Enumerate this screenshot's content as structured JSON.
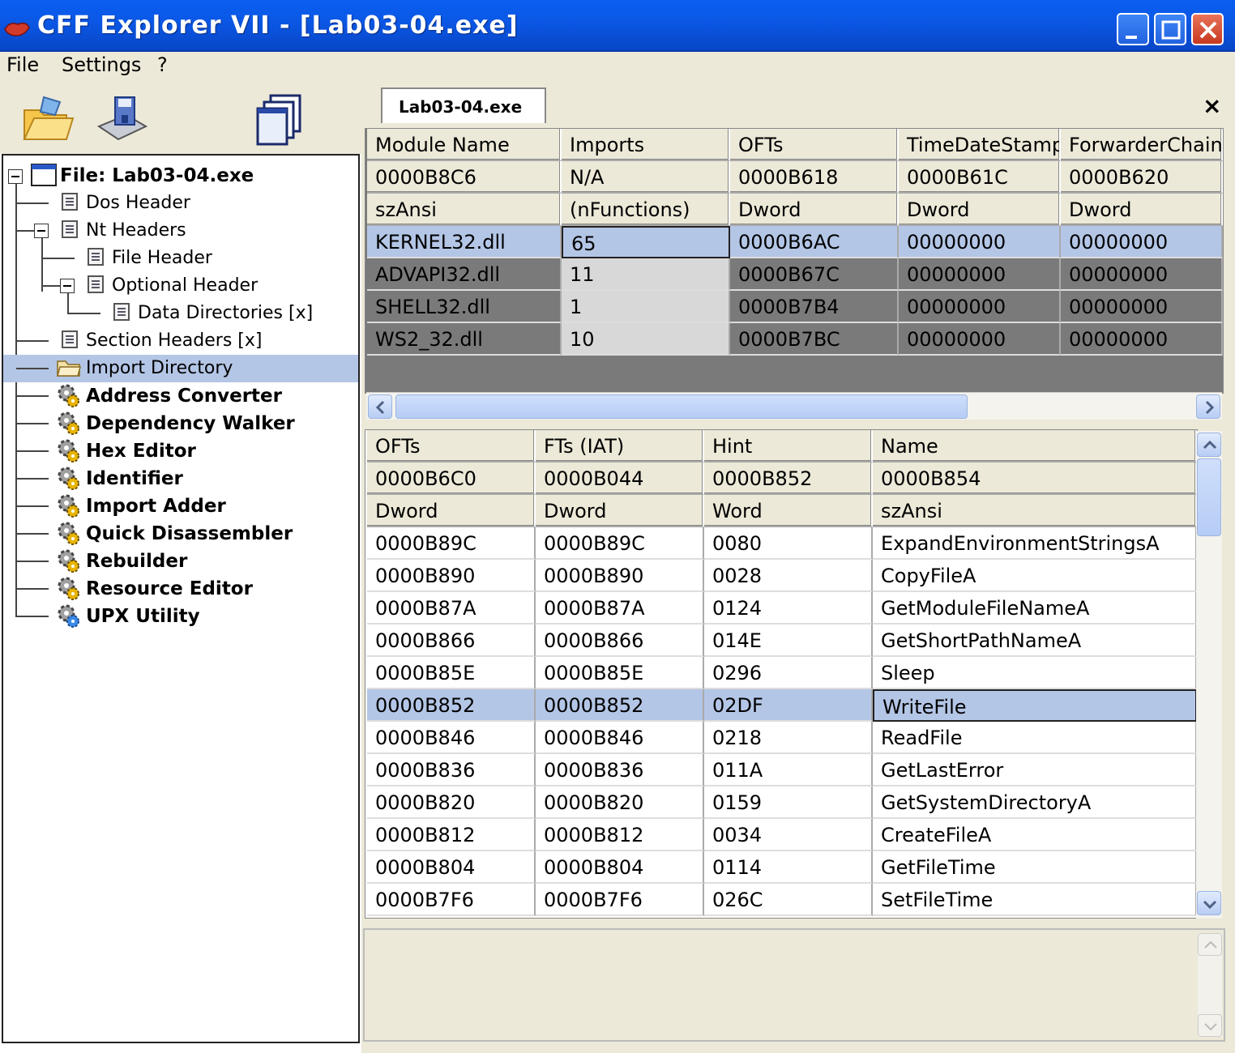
{
  "window": {
    "title": "CFF Explorer VII - [Lab03-04.exe]"
  },
  "menu": {
    "items": [
      "File",
      "Settings",
      "?"
    ]
  },
  "toolbar": {
    "tools": [
      "open-folder-icon",
      "save-disk-icon",
      "windows-icon"
    ]
  },
  "tree": {
    "root": "File: Lab03-04.exe",
    "items": [
      {
        "label": "Dos Header"
      },
      {
        "label": "Nt Headers"
      },
      {
        "label": "File Header"
      },
      {
        "label": "Optional Header"
      },
      {
        "label": "Data Directories [x]"
      },
      {
        "label": "Section Headers [x]"
      },
      {
        "label": "Import Directory"
      },
      {
        "label": "Address Converter"
      },
      {
        "label": "Dependency Walker"
      },
      {
        "label": "Hex Editor"
      },
      {
        "label": "Identifier"
      },
      {
        "label": "Import Adder"
      },
      {
        "label": "Quick Disassembler"
      },
      {
        "label": "Rebuilder"
      },
      {
        "label": "Resource Editor"
      },
      {
        "label": "UPX Utility"
      }
    ]
  },
  "tab": {
    "label": "Lab03-04.exe",
    "close": "×"
  },
  "modules_table": {
    "headers": [
      "Module Name",
      "Imports",
      "OFTs",
      "TimeDateStamp",
      "ForwarderChain"
    ],
    "offsets": [
      "0000B8C6",
      "N/A",
      "0000B618",
      "0000B61C",
      "0000B620"
    ],
    "types": [
      "szAnsi",
      "(nFunctions)",
      "Dword",
      "Dword",
      "Dword"
    ],
    "rows": [
      [
        "KERNEL32.dll",
        "65",
        "0000B6AC",
        "00000000",
        "00000000"
      ],
      [
        "ADVAPI32.dll",
        "11",
        "0000B67C",
        "00000000",
        "00000000"
      ],
      [
        "SHELL32.dll",
        "1",
        "0000B7B4",
        "00000000",
        "00000000"
      ],
      [
        "WS2_32.dll",
        "10",
        "0000B7BC",
        "00000000",
        "00000000"
      ]
    ]
  },
  "functions_table": {
    "headers": [
      "OFTs",
      "FTs (IAT)",
      "Hint",
      "Name"
    ],
    "offsets": [
      "0000B6C0",
      "0000B044",
      "0000B852",
      "0000B854"
    ],
    "types": [
      "Dword",
      "Dword",
      "Word",
      "szAnsi"
    ],
    "rows": [
      [
        "0000B89C",
        "0000B89C",
        "0080",
        "ExpandEnvironmentStringsA"
      ],
      [
        "0000B890",
        "0000B890",
        "0028",
        "CopyFileA"
      ],
      [
        "0000B87A",
        "0000B87A",
        "0124",
        "GetModuleFileNameA"
      ],
      [
        "0000B866",
        "0000B866",
        "014E",
        "GetShortPathNameA"
      ],
      [
        "0000B85E",
        "0000B85E",
        "0296",
        "Sleep"
      ],
      [
        "0000B852",
        "0000B852",
        "02DF",
        "WriteFile"
      ],
      [
        "0000B846",
        "0000B846",
        "0218",
        "ReadFile"
      ],
      [
        "0000B836",
        "0000B836",
        "011A",
        "GetLastError"
      ],
      [
        "0000B820",
        "0000B820",
        "0159",
        "GetSystemDirectoryA"
      ],
      [
        "0000B812",
        "0000B812",
        "0034",
        "CreateFileA"
      ],
      [
        "0000B804",
        "0000B804",
        "0114",
        "GetFileTime"
      ],
      [
        "0000B7F6",
        "0000B7F6",
        "026C",
        "SetFileTime"
      ]
    ]
  }
}
